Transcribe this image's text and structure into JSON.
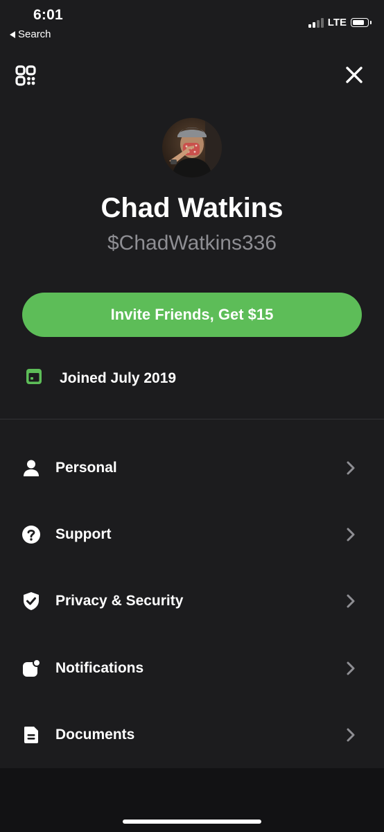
{
  "status_bar": {
    "time": "6:01",
    "back_label": "Search",
    "network": "LTE"
  },
  "top_bar": {
    "left_icon": "qr-code-icon",
    "right_icon": "close-icon"
  },
  "profile": {
    "name": "Chad Watkins",
    "cashtag": "$ChadWatkins336"
  },
  "invite_button": {
    "label": "Invite Friends, Get $15",
    "color": "#5dbd58"
  },
  "joined": {
    "icon": "calendar-icon",
    "label": "Joined July 2019"
  },
  "menu": {
    "items": [
      {
        "label": "Personal",
        "icon": "person-icon"
      },
      {
        "label": "Support",
        "icon": "question-icon"
      },
      {
        "label": "Privacy & Security",
        "icon": "shield-check-icon"
      },
      {
        "label": "Notifications",
        "icon": "notification-icon"
      },
      {
        "label": "Documents",
        "icon": "document-icon"
      }
    ]
  },
  "colors": {
    "background": "#1c1c1e",
    "accent": "#5dbd58",
    "secondary_text": "#8e8e93",
    "chevron": "#8e8e93"
  }
}
